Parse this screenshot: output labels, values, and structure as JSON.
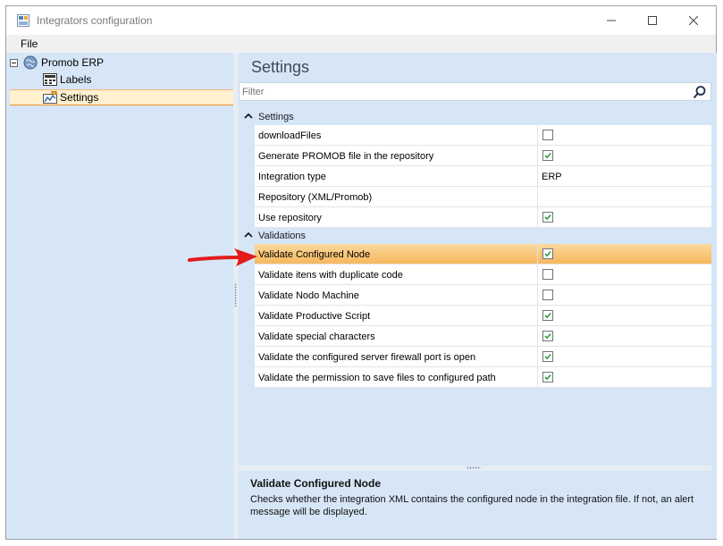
{
  "window": {
    "title": "Integrators configuration"
  },
  "menu": {
    "file": "File"
  },
  "tree": {
    "root": "Promob ERP",
    "children": [
      "Labels",
      "Settings"
    ],
    "selected": "Settings"
  },
  "panel": {
    "heading": "Settings",
    "filter_placeholder": "Filter"
  },
  "categories": [
    {
      "label": "Settings",
      "properties": [
        {
          "name": "downloadFiles",
          "type": "checkbox",
          "checked": false
        },
        {
          "name": "Generate PROMOB file in the repository",
          "type": "checkbox",
          "checked": true
        },
        {
          "name": "Integration type",
          "type": "text",
          "value": "ERP"
        },
        {
          "name": "Repository (XML/Promob)",
          "type": "text",
          "value": ""
        },
        {
          "name": "Use repository",
          "type": "checkbox",
          "checked": true
        }
      ]
    },
    {
      "label": "Validations",
      "properties": [
        {
          "name": "Validate Configured Node",
          "type": "checkbox",
          "checked": true,
          "selected": true
        },
        {
          "name": "Validate itens with duplicate code",
          "type": "checkbox",
          "checked": false
        },
        {
          "name": "Validate Nodo Machine",
          "type": "checkbox",
          "checked": false
        },
        {
          "name": "Validate Productive Script",
          "type": "checkbox",
          "checked": true
        },
        {
          "name": "Validate special characters",
          "type": "checkbox",
          "checked": true
        },
        {
          "name": "Validate the configured server firewall port is open",
          "type": "checkbox",
          "checked": true
        },
        {
          "name": "Validate the permission to save files to configured path",
          "type": "checkbox",
          "checked": true
        }
      ]
    }
  ],
  "description": {
    "title": "Validate Configured Node",
    "text": "Checks whether the integration XML contains the configured node in the integration file. If not, an alert message will be displayed."
  },
  "colors": {
    "panel_bg": "#d6e6f7",
    "selection": "#f7b75b",
    "annotation_arrow": "#e21b1b",
    "check_green": "#2e9e3f"
  },
  "icons": {
    "app": "app-icon",
    "root": "globe-icon",
    "labels": "labels-icon",
    "settings": "settings-icon",
    "filter": "search-icon"
  }
}
